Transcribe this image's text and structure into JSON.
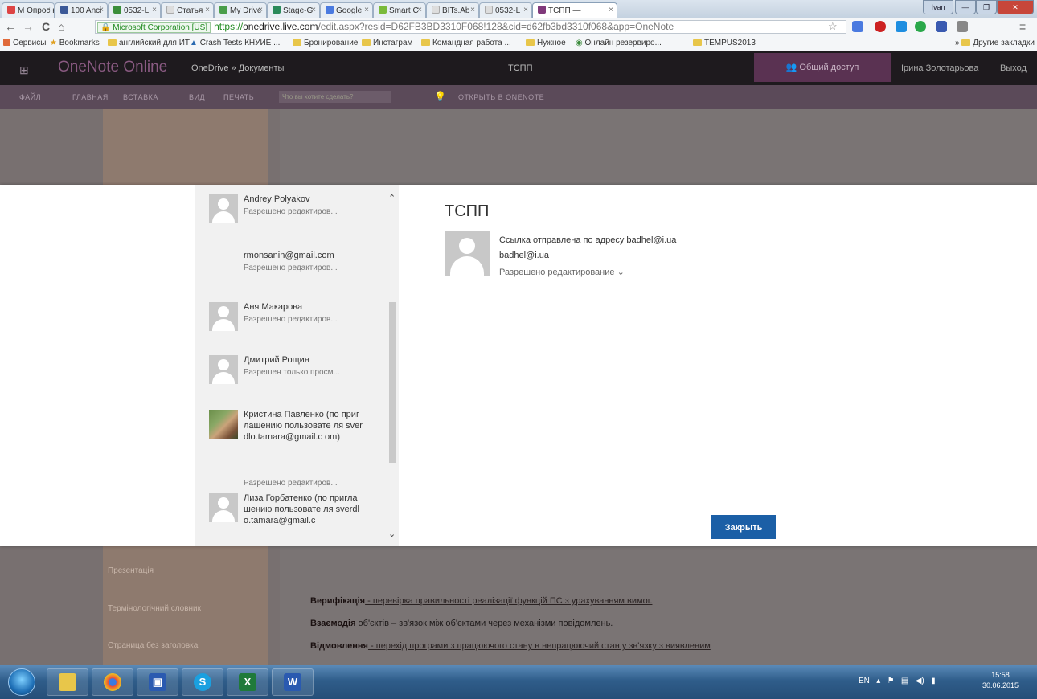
{
  "browser": {
    "tabs": [
      "M Опрос н",
      "100 Anci",
      "0532-L",
      "Статья",
      "My Drive",
      "Stage-G",
      "Google",
      "Smart C",
      "BITs.Ab",
      "0532-L"
    ],
    "active_tab": "ТСПП —",
    "window_controls": [
      "Ivan",
      "—",
      "❐",
      "✕"
    ],
    "back": "←",
    "forward": "→",
    "reload": "C",
    "home": "⌂",
    "cert_label": "Microsoft Corporation [US]",
    "url_scheme": "https://",
    "url_host": "onedrive.live.com",
    "url_path": "/edit.aspx?resid=D62FB3BD3310F068!128&cid=d62fb3bd3310f068&app=OneNote",
    "star": "☆",
    "menu": "≡"
  },
  "bookmarks": {
    "items": [
      "Сервисы",
      "Bookmarks",
      "английский для ИТ",
      "Crash Tests КНУИЕ ...",
      "Бронирование",
      "Инстаграм",
      "Командная работа ...",
      "Нужное",
      "Онлайн резервиро...",
      "TEMPUS2013"
    ],
    "other": "Другие закладки"
  },
  "suitebar": {
    "waffle": "⊞",
    "app_name": "OneNote Online",
    "breadcrumb": "OneDrive » Документы",
    "doc_title": "ТСПП",
    "share_label": "Общий доступ",
    "user_name": "Ірина Золотарьова",
    "sign_out": "Выход"
  },
  "ribbon": {
    "tabs": [
      "ФАЙЛ",
      "ГЛАВНАЯ",
      "ВСТАВКА",
      "ВИД",
      "ПЕЧАТЬ"
    ],
    "tell_me_placeholder": "Что вы хотите сделать?",
    "open_in_onenote": "ОТКРЫТЬ В ONENOTE"
  },
  "background": {
    "pages": [
      "Презентація",
      "Термінологічний словник",
      "Страница без заголовка"
    ],
    "notes": [
      {
        "term": "Верифікація",
        "text": " - перевірка правильності реалізації функцій ПС з урахуванням вимог."
      },
      {
        "term": "Взаємодія",
        "text": " об'єктів – зв'язок між об'єктами через механізми повідомлень."
      },
      {
        "term": "Відмовлення",
        "text": " - перехід програми з працюючого стану в непрацюючий стан у зв'язку з виявленим"
      }
    ]
  },
  "dialog": {
    "contacts": [
      {
        "name": "Andrey Polyakov",
        "permission": "Разрешено редактиров..."
      },
      {
        "name": "rmonsanin@gmail.com",
        "permission": "Разрешено редактиров..."
      },
      {
        "name": "Аня Макарова",
        "permission": "Разрешено редактиров..."
      },
      {
        "name": "Дмитрий Рощин",
        "permission": "Разрешен только просм..."
      },
      {
        "name": "Кристина Павленко (по приглашению пользовате ля sverdlo.tamara@gmail.c om)",
        "permission": "Разрешено редактиров..."
      },
      {
        "name": "Лиза Горбатенко (по приглашению пользовате ля sverdlo.tamara@gmail.c",
        "permission": ""
      }
    ],
    "title": "ТСПП",
    "sent_message": "Ссылка отправлена по адресу badhel@i.ua",
    "recipient_email": "badhel@i.ua",
    "recipient_permission": "Разрешено редактирование",
    "close_label": "Закрыть"
  },
  "taskbar": {
    "apps": [
      "explorer",
      "chrome",
      "save",
      "skype",
      "excel",
      "word"
    ],
    "lang": "EN",
    "time": "15:58",
    "date": "30.06.2015"
  },
  "colors": {
    "suitebar": "#1e1a1e",
    "app_accent": "#80397b",
    "close_button": "#1b5fa6",
    "overlay": "#787070"
  }
}
